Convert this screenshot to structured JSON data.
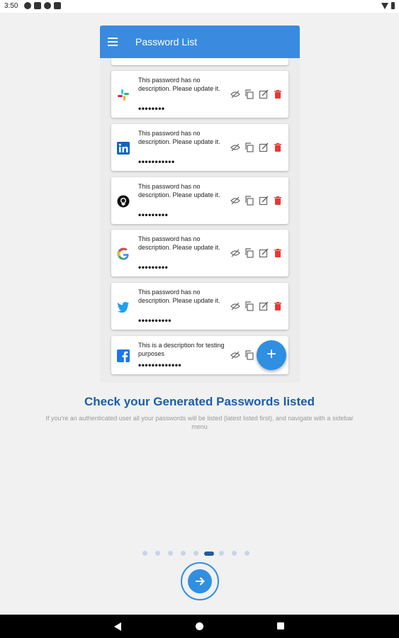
{
  "status_bar": {
    "time": "3:50"
  },
  "app": {
    "title": "Password List"
  },
  "cards": [
    {
      "service": "slack",
      "description": "This password has no description. Please update it.",
      "masked": "••••••••"
    },
    {
      "service": "linkedin",
      "description": "This password has no description. Please update it.",
      "masked": "•••••••••••"
    },
    {
      "service": "github",
      "description": "This password has no description. Please update it.",
      "masked": "•••••••••"
    },
    {
      "service": "google",
      "description": "This password has no description. Please update it.",
      "masked": "•••••••••"
    },
    {
      "service": "twitter",
      "description": "This password has no description. Please update it.",
      "masked": "••••••••••"
    },
    {
      "service": "facebook",
      "description": "This is a description for testing purposes",
      "masked": "•••••••••••••"
    }
  ],
  "fab": {
    "label": "+"
  },
  "onboarding": {
    "headline": "Check your Generated Passwords listed",
    "subtext": "If you're an authenticated user all your passwords will be listed (latest listed first), and navigate with a sidebar menu",
    "current_page": 6,
    "total_pages": 9
  },
  "icons": {
    "status": [
      "notification-a-icon",
      "notification-b-icon",
      "notification-c-icon",
      "notification-d-icon"
    ],
    "actions": [
      "hide-visibility-icon",
      "copy-icon",
      "edit-icon",
      "delete-icon"
    ],
    "next": "arrow-right-icon"
  },
  "colors": {
    "primary": "#3a8be0",
    "headline": "#1a5eaa",
    "delete": "#e53935",
    "dot_active": "#1f5aa0",
    "dot_inactive": "#c5d6e8"
  }
}
